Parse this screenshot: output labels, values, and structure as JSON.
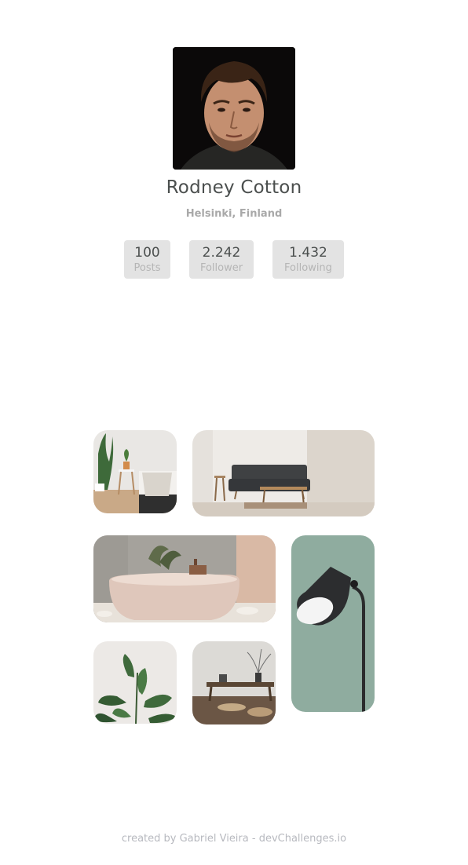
{
  "profile": {
    "name": "Rodney Cotton",
    "location": "Helsinki, Finland"
  },
  "stats": [
    {
      "value": "100",
      "label": "Posts"
    },
    {
      "value": "2.242",
      "label": "Follower"
    },
    {
      "value": "1.432",
      "label": "Following"
    }
  ],
  "gallery": {
    "photos": [
      "bedroom-photo",
      "living-room-photo",
      "bathtub-photo",
      "lamp-photo",
      "plant-photo",
      "table-photo"
    ]
  },
  "footer": {
    "credit": "created by Gabriel Vieira - devChallenges.io"
  },
  "colors": {
    "name_text": "#4b4f4e",
    "muted_text": "#a9a9a9",
    "stat_bg": "#e3e3e3",
    "footer_text": "#b7b9bf"
  }
}
